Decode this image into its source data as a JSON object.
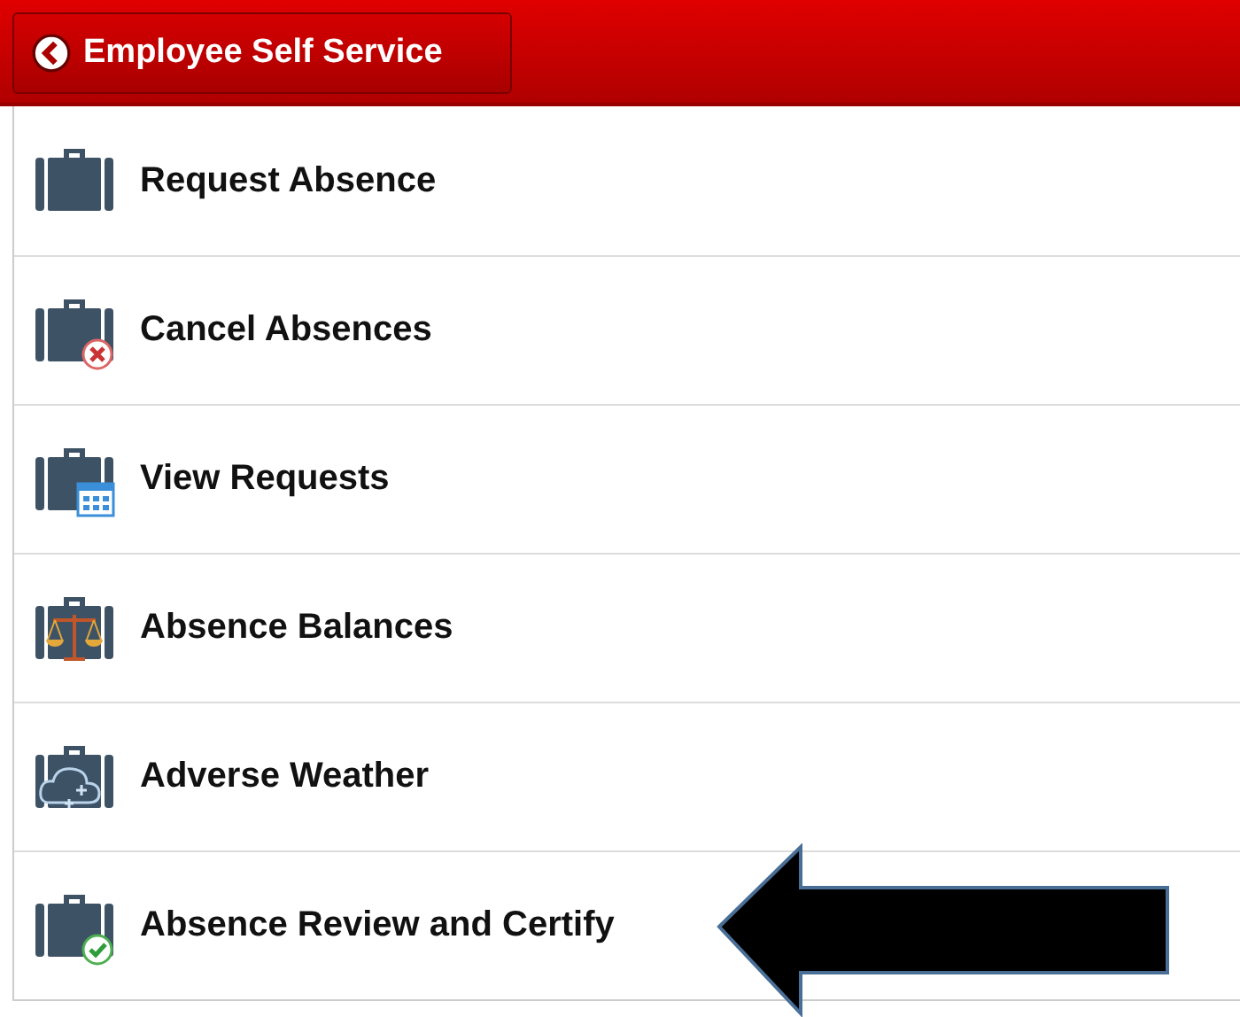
{
  "header": {
    "back_button": {
      "label": "Employee Self Service"
    }
  },
  "items": [
    {
      "label": "Request Absence",
      "kind": "plain"
    },
    {
      "label": "Cancel Absences",
      "kind": "cancel"
    },
    {
      "label": "View Requests",
      "kind": "calendar"
    },
    {
      "label": "Absence Balances",
      "kind": "scales"
    },
    {
      "label": "Adverse Weather",
      "kind": "weather"
    },
    {
      "label": "Absence Review and Certify",
      "kind": "check"
    }
  ]
}
